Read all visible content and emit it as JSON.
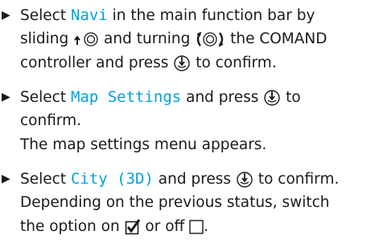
{
  "steps": [
    {
      "bullet": "▶",
      "lines": {
        "l1_pre": "Select ",
        "l1_menu": "Navi",
        "l1_post": " in the main function bar by",
        "l2_a": "sliding ",
        "l2_b": " and turning ",
        "l2_c": " the COMAND",
        "l3_a": "controller and press ",
        "l3_b": " to confirm."
      }
    },
    {
      "bullet": "▶",
      "lines": {
        "l1_pre": "Select ",
        "l1_menu": "Map Settings",
        "l1_post": " and press ",
        "l1_tail": " to",
        "l2": "confirm.",
        "l3": "The map settings menu appears."
      }
    },
    {
      "bullet": "▶",
      "lines": {
        "l1_pre": "Select ",
        "l1_menu": "City (3D)",
        "l1_post": " and press ",
        "l1_tail": " to confirm.",
        "l2": "Depending on the previous status, switch",
        "l3_a": "the option on ",
        "l3_b": " or off ",
        "l3_c": "."
      }
    }
  ],
  "colors": {
    "menu_text": "#00a3d9",
    "text": "#1a1a1a"
  },
  "icons": [
    "slide-up-controller-icon",
    "turn-controller-icon",
    "press-controller-icon",
    "checkbox-checked-icon",
    "checkbox-empty-icon"
  ]
}
